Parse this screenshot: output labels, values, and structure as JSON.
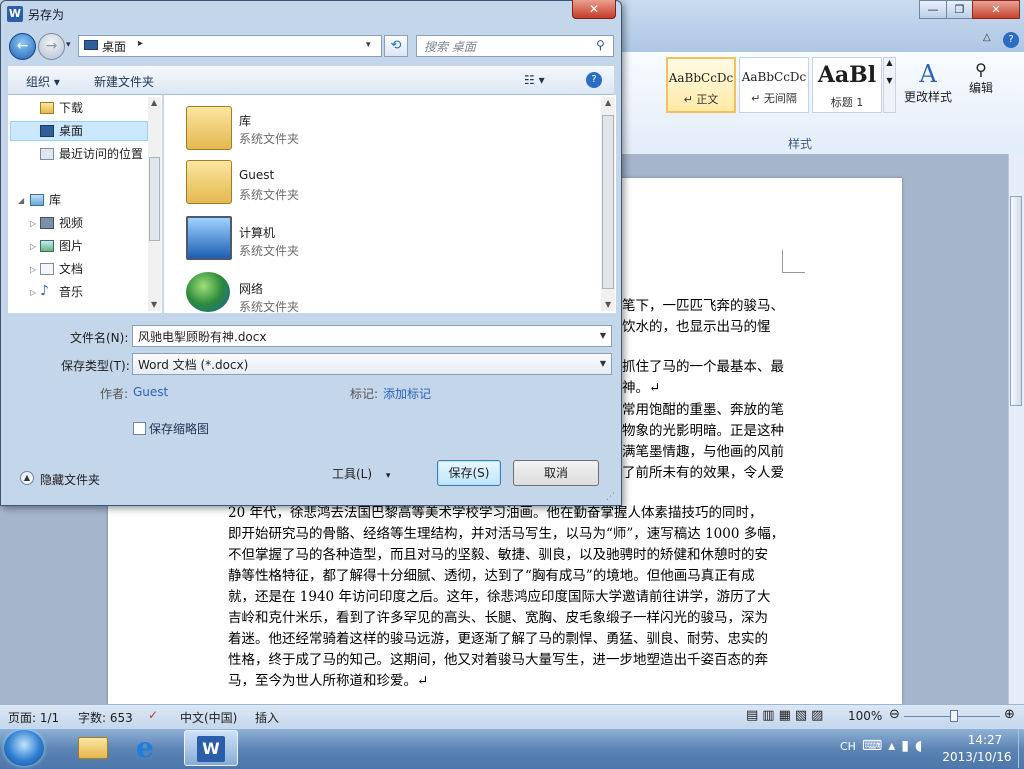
{
  "dialog": {
    "title": "另存为",
    "title_icon": "W",
    "close_glyph": "✕",
    "address": {
      "location": "桌面",
      "separator": "▸",
      "dropdown": "▾"
    },
    "refresh_glyph": "⟲",
    "search_placeholder": "搜索 桌面",
    "toolbar": {
      "organize": "组织 ▾",
      "new_folder": "新建文件夹",
      "views": "☷ ▾",
      "help": "?"
    },
    "nav_items": [
      {
        "label": "下载",
        "icon": "downloads-folder-icon"
      },
      {
        "label": "桌面",
        "icon": "desktop-icon",
        "selected": true
      },
      {
        "label": "最近访问的位置",
        "icon": "recent-places-icon"
      },
      {
        "label": "库",
        "icon": "library-icon"
      },
      {
        "label": "视频",
        "icon": "videos-icon"
      },
      {
        "label": "图片",
        "icon": "pictures-icon"
      },
      {
        "label": "文档",
        "icon": "documents-icon"
      },
      {
        "label": "音乐",
        "icon": "music-icon"
      }
    ],
    "files": [
      {
        "name": "库",
        "type": "系统文件夹",
        "icon": "library-folder-icon"
      },
      {
        "name": "Guest",
        "type": "系统文件夹",
        "icon": "user-folder-icon"
      },
      {
        "name": "计算机",
        "type": "系统文件夹",
        "icon": "computer-icon"
      },
      {
        "name": "网络",
        "type": "系统文件夹",
        "icon": "network-icon"
      }
    ],
    "filename_label": "文件名(N):",
    "filename_value": "风驰电掣顾盼有神.docx",
    "filetype_label": "保存类型(T):",
    "filetype_value": "Word 文档 (*.docx)",
    "author_label": "作者:",
    "author_value": "Guest",
    "tags_label": "标记:",
    "tags_value": "添加标记",
    "thumbnail_label": "保存缩略图",
    "hide_folders": "隐藏文件夹",
    "tools": "工具(L)",
    "tools_arrow": "▾",
    "save": "保存(S)",
    "cancel": "取消"
  },
  "word": {
    "window_controls": {
      "min": "—",
      "max": "❐",
      "close": "✕"
    },
    "styles": [
      {
        "preview": "AaBbCcDc",
        "label": "↵ 正文"
      },
      {
        "preview": "AaBbCcDc",
        "label": "↵ 无间隔"
      },
      {
        "preview": "AaBl",
        "label": "标题 1"
      }
    ],
    "change_styles": "更改样式",
    "edit": "编辑",
    "styles_group": "样式",
    "doc_side_lines": [
      "笔下，一匹匹飞奔的骏马、",
      "饮水的，也显示出马的惺",
      "抓住了马的一个最基本、最",
      "神。↵",
      "常用饱酣的重墨、奔放的笔",
      "物象的光影明暗。正是这种",
      "满笔墨情趣，与他画的风前",
      "了前所未有的效果，令人爱"
    ],
    "doc_lines": [
      "20 年代，徐悲鸿去法国巴黎高等美术学校学习油画。他在勤奋掌握人体素描技巧的同时，",
      "即开始研究马的骨骼、经络等生理结构，并对活马写生，以马为“师”，速写稿达 1000 多幅，",
      "不但掌握了马的各种造型，而且对马的坚毅、敏捷、驯良，以及驰骋时的矫健和休憩时的安",
      "静等性格特征，都了解得十分细腻、透彻，达到了“胸有成马”的境地。但他画马真正有成",
      "就，还是在 1940 年访问印度之后。这年，徐悲鸿应印度国际大学邀请前往讲学，游历了大",
      "吉岭和克什米乐，看到了许多罕见的高头、长腿、宽胸、皮毛象缎子一样闪光的骏马，深为",
      "着迷。他还经常骑着这样的骏马远游，更逐渐了解了马的剽悍、勇猛、驯良、耐劳、忠实的",
      "性格，终于成了马的知己。这期间，他又对着骏马大量写生，进一步地塑造出千姿百态的奔",
      "马，至今为世人所称道和珍爱。↵"
    ],
    "status": {
      "page": "页面: 1/1",
      "words": "字数: 653",
      "lang": "中文(中国)",
      "mode": "插入",
      "zoom": "100%",
      "zoom_level": 1.0
    }
  },
  "taskbar": {
    "lang": "CH",
    "time": "14:27",
    "date": "2013/10/16"
  }
}
